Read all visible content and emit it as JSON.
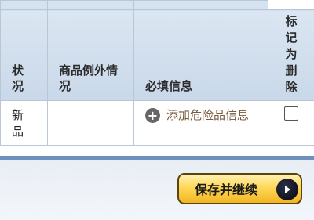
{
  "table": {
    "columns": {
      "status": "状况",
      "exception": "商品例外情况",
      "required": "必填信息",
      "mark_delete": "标记为删除"
    },
    "rows": [
      {
        "status": "新品",
        "exception": "",
        "add_link_label": "添加危险品信息",
        "marked_for_delete": false
      }
    ]
  },
  "footer": {
    "save_continue_label": "保存并继续"
  }
}
